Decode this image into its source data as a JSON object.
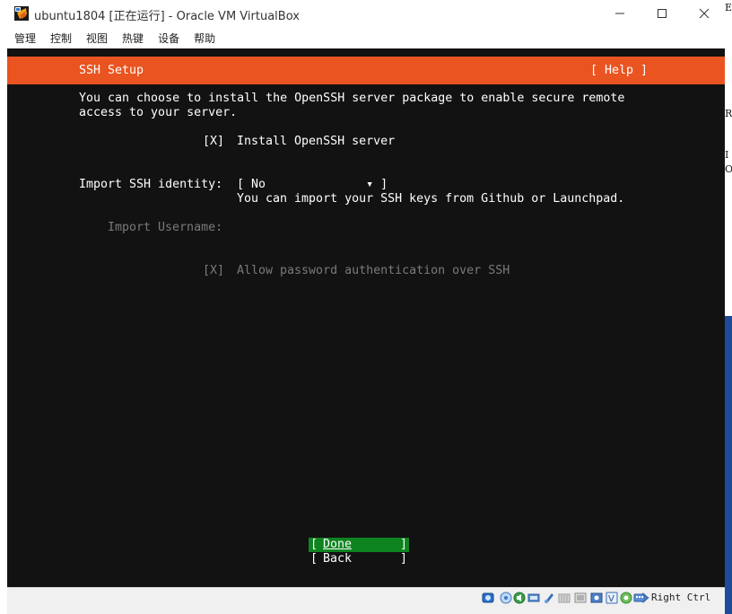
{
  "window": {
    "title": "ubuntu1804 [正在运行] - Oracle VM VirtualBox",
    "icon": "virtualbox-icon"
  },
  "menu": {
    "items": [
      "管理",
      "控制",
      "视图",
      "热键",
      "设备",
      "帮助"
    ]
  },
  "installer": {
    "header_title": "SSH Setup",
    "help_button": "[ Help ]",
    "description_line1": "You can choose to install the OpenSSH server package to enable secure remote",
    "description_line2": "access to your server.",
    "install_checkbox": "[X]",
    "install_label": "Install OpenSSH server",
    "import_label": "Import SSH identity:",
    "import_select": "[ No              ▾ ]",
    "import_hint": "You can import your SSH keys from Github or Launchpad.",
    "username_label": "Import Username:",
    "password_checkbox": "[X]",
    "password_label": "Allow password authentication over SSH",
    "done_button": {
      "open": "[",
      "label": "Done",
      "close": "]"
    },
    "back_button": {
      "open": "[",
      "label": "Back",
      "close": "]"
    }
  },
  "statusbar": {
    "host_key": "Right Ctrl"
  },
  "background": {
    "chars": [
      "E",
      "R",
      "I",
      "O"
    ]
  },
  "colors": {
    "accent": "#e95420",
    "done_bg": "#0e8420",
    "screen_bg": "#121212",
    "disabled_text": "#7a7a7a"
  }
}
